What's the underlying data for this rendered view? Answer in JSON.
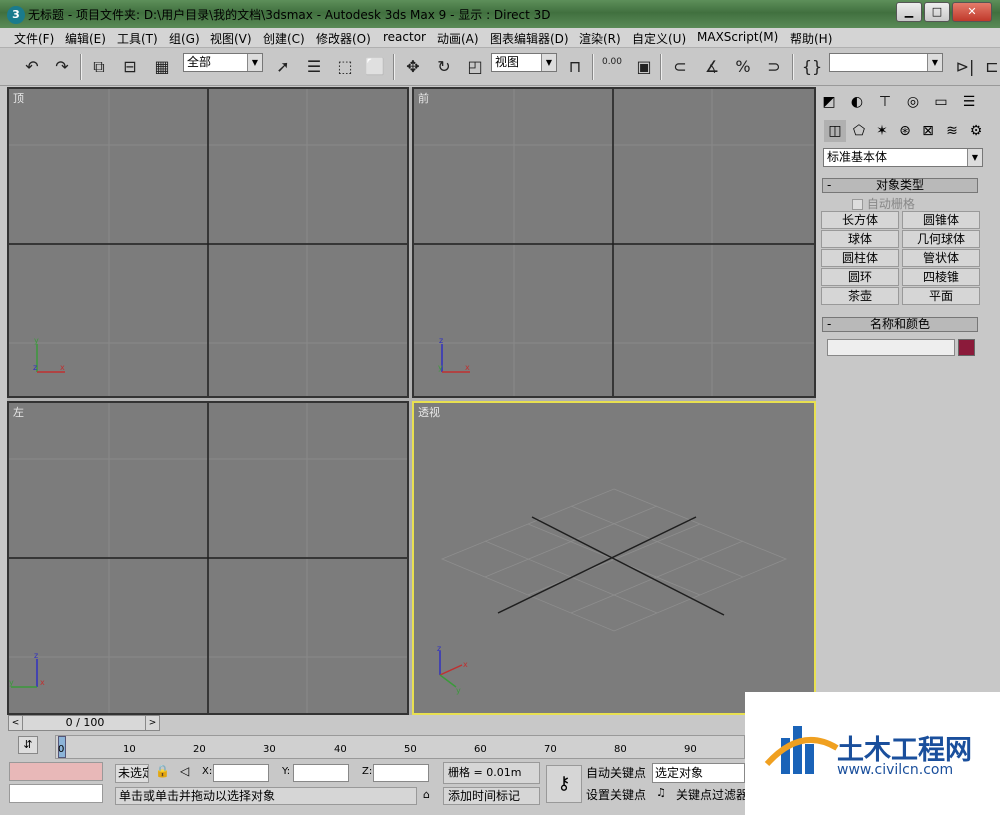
{
  "window": {
    "title": "无标题    - 项目文件夹: D:\\用户目录\\我的文档\\3dsmax    - Autodesk 3ds Max 9    - 显示 : Direct 3D",
    "app_icon": "3ds-max-icon",
    "controls": [
      "minimize-icon",
      "maximize-icon",
      "close-icon"
    ]
  },
  "menu": [
    "文件(F)",
    "编辑(E)",
    "工具(T)",
    "组(G)",
    "视图(V)",
    "创建(C)",
    "修改器(O)",
    "reactor",
    "动画(A)",
    "图表编辑器(D)",
    "渲染(R)",
    "自定义(U)",
    "MAXScript(M)",
    "帮助(H)"
  ],
  "toolbar": {
    "selection_filter": "全部",
    "reference_coord": "视图",
    "snap_value": "0.00",
    "named_selection": ""
  },
  "viewports": [
    {
      "label": "顶"
    },
    {
      "label": "前"
    },
    {
      "label": "左"
    },
    {
      "label": "透视"
    }
  ],
  "axis": {
    "x": "x",
    "y": "y",
    "z": "z"
  },
  "command_panel": {
    "category": "标准基本体",
    "object_type_title": "对象类型",
    "autogrid": "自动栅格",
    "buttons": [
      "长方体",
      "圆锥体",
      "球体",
      "几何球体",
      "圆柱体",
      "管状体",
      "圆环",
      "四棱锥",
      "茶壶",
      "平面"
    ],
    "name_color_title": "名称和颜色",
    "name_value": "",
    "object_color": "#8b1a3a",
    "rollout_toggle": "-"
  },
  "timeline": {
    "time_slider": "0 / 100",
    "ticks": [
      "0",
      "10",
      "20",
      "30",
      "40",
      "50",
      "60",
      "70",
      "80",
      "90"
    ]
  },
  "status": {
    "selection": "未选定",
    "x_label": "X:",
    "y_label": "Y:",
    "z_label": "Z:",
    "grid": "栅格 = 0.01m",
    "auto_key": "自动关键点",
    "set_key": "设置关键点",
    "selected_object": "选定对象",
    "key_filter": "关键点过滤器",
    "prompt": "单击或单击并拖动以选择对象",
    "add_time_tag": "添加时间标记"
  },
  "watermark": {
    "brand": "土木工程网",
    "url": "www.civilcn.com"
  }
}
